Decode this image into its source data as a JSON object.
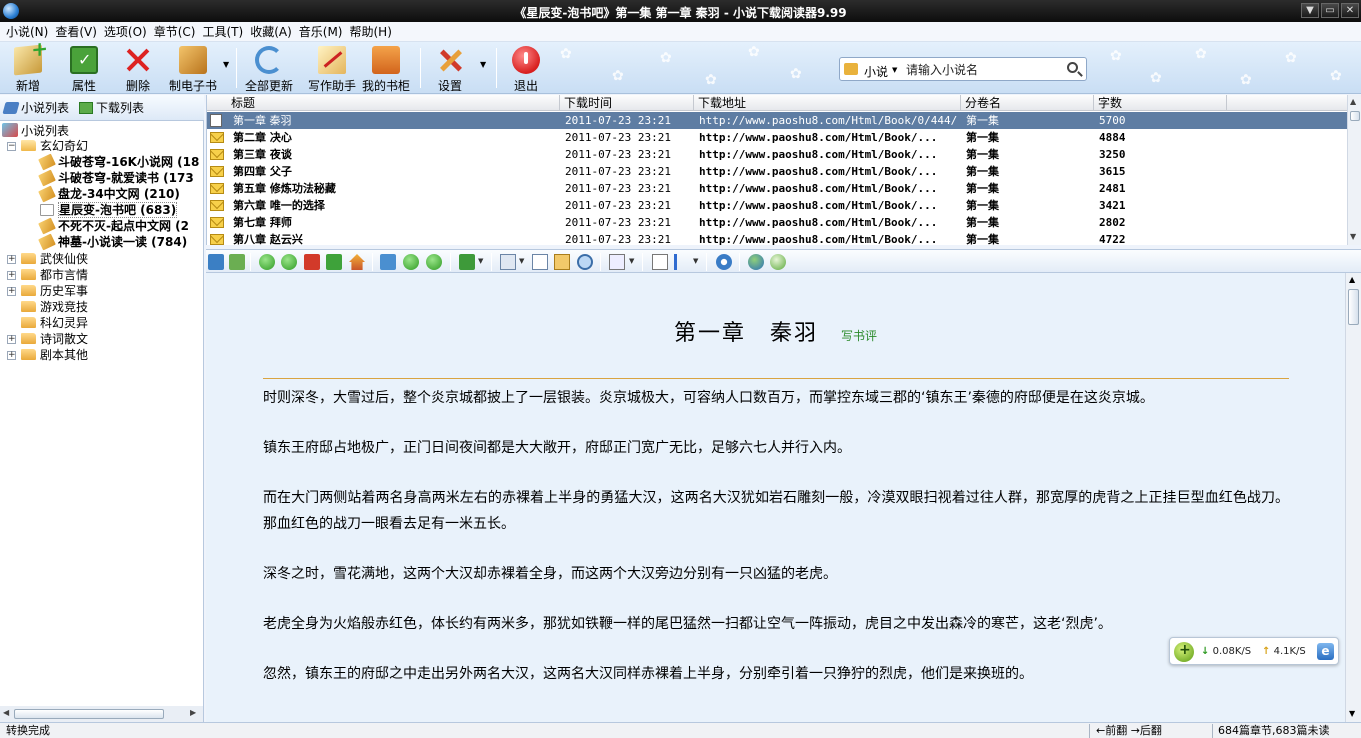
{
  "window": {
    "title": "《星辰变-泡书吧》第一集 第一章 秦羽 - 小说下载阅读器9.99",
    "buttons": [
      "▼",
      "▭",
      "✕"
    ]
  },
  "menu": [
    "小说(N)",
    "查看(V)",
    "选项(O)",
    "章节(C)",
    "工具(T)",
    "收藏(A)",
    "音乐(M)",
    "帮助(H)"
  ],
  "toolbar": {
    "new": "新增",
    "properties": "属性",
    "delete": "删除",
    "make_ebook": "制电子书",
    "update_all": "全部更新",
    "writing_assistant": "写作助手",
    "my_bookshelf": "我的书柜",
    "settings": "设置",
    "exit": "退出"
  },
  "search": {
    "scope": "小说",
    "placeholder": "请输入小说名"
  },
  "left_tabs": [
    "小说列表",
    "下载列表"
  ],
  "tree": {
    "root": "小说列表",
    "categories": {
      "xuanhuan": "玄幻奇幻",
      "wuxia": "武侠仙侠",
      "dushi": "都市言情",
      "lishi": "历史军事",
      "youxi": "游戏竞技",
      "kehuan": "科幻灵异",
      "shici": "诗词散文",
      "juben": "剧本其他"
    },
    "novels": [
      "斗破苍穹-16K小说网 (18",
      "斗破苍穹-就爱读书 (173",
      "盘龙-34中文网 (210)",
      "星辰变-泡书吧 (683)",
      "不死不灭-起点中文网 (2",
      "神墓-小说读一读 (784)"
    ]
  },
  "chapter_table": {
    "columns": [
      "标题",
      "下载时间",
      "下载地址",
      "分卷名",
      "字数"
    ],
    "rows": [
      {
        "title": "第一章 秦羽",
        "time": "2011-07-23 23:21",
        "url": "http://www.paoshu8.com/Html/Book/0/444/...",
        "volume": "第一集",
        "words": "5700"
      },
      {
        "title": "第二章 决心",
        "time": "2011-07-23 23:21",
        "url": "http://www.paoshu8.com/Html/Book/...",
        "volume": "第一集",
        "words": "4884"
      },
      {
        "title": "第三章 夜谈",
        "time": "2011-07-23 23:21",
        "url": "http://www.paoshu8.com/Html/Book/...",
        "volume": "第一集",
        "words": "3250"
      },
      {
        "title": "第四章 父子",
        "time": "2011-07-23 23:21",
        "url": "http://www.paoshu8.com/Html/Book/...",
        "volume": "第一集",
        "words": "3615"
      },
      {
        "title": "第五章 修炼功法秘藏",
        "time": "2011-07-23 23:21",
        "url": "http://www.paoshu8.com/Html/Book/...",
        "volume": "第一集",
        "words": "2481"
      },
      {
        "title": "第六章 唯一的选择",
        "time": "2011-07-23 23:21",
        "url": "http://www.paoshu8.com/Html/Book/...",
        "volume": "第一集",
        "words": "3421"
      },
      {
        "title": "第七章 拜师",
        "time": "2011-07-23 23:21",
        "url": "http://www.paoshu8.com/Html/Book/...",
        "volume": "第一集",
        "words": "2802"
      },
      {
        "title": "第八章 赵云兴",
        "time": "2011-07-23 23:21",
        "url": "http://www.paoshu8.com/Html/Book/...",
        "volume": "第一集",
        "words": "4722"
      }
    ]
  },
  "reader": {
    "chapter_title": "第一章　秦羽",
    "review_link": "写书评",
    "paragraphs": [
      "时则深冬，大雪过后，整个炎京城都披上了一层银装。炎京城极大，可容纳人口数百万，而掌控东域三郡的‘镇东王’秦德的府邸便是在这炎京城。",
      "镇东王府邸占地极广，正门日间夜间都是大大敞开，府邸正门宽广无比，足够六七人并行入内。",
      "而在大门两侧站着两名身高两米左右的赤裸着上半身的勇猛大汉，这两名大汉犹如岩石雕刻一般，冷漠双眼扫视着过往人群，那宽厚的虎背之上正挂巨型血红色战刀。那血红色的战刀一眼看去足有一米五长。",
      "深冬之时，雪花满地，这两个大汉却赤裸着全身，而这两个大汉旁边分别有一只凶猛的老虎。",
      "老虎全身为火焰般赤红色，体长约有两米多，那犹如铁鞭一样的尾巴猛然一扫都让空气一阵振动，虎目之中发出森冷的寒芒，这老‘烈虎’。",
      "忽然，镇东王的府邸之中走出另外两名大汉，这两名大汉同样赤裸着上半身，分别牵引着一只狰狞的烈虎，他们是来换班的。"
    ]
  },
  "speed": {
    "down_arrow": "↓",
    "down": "0.08K/S",
    "up_arrow": "↑",
    "up": "4.1K/S"
  },
  "status": {
    "left": "转换完成",
    "nav": "←前翻 →后翻",
    "summary": "684篇章节,683篇未读"
  }
}
